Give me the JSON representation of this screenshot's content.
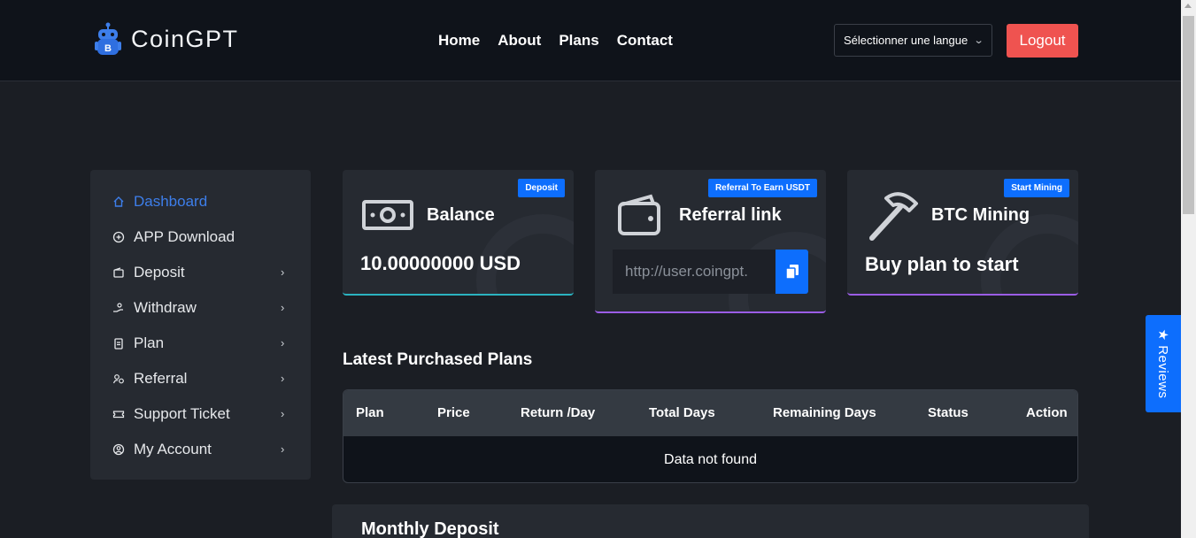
{
  "brand": {
    "name": "CoinGPT",
    "logo_icon": "robot-bitcoin-icon"
  },
  "nav": {
    "items": [
      "Home",
      "About",
      "Plans",
      "Contact"
    ]
  },
  "header": {
    "language_select": "Sélectionner une langue",
    "logout_label": "Logout"
  },
  "sidebar": {
    "items": [
      {
        "label": "Dashboard",
        "icon": "home-icon",
        "active": true,
        "has_submenu": false
      },
      {
        "label": "APP Download",
        "icon": "plus-circle-icon",
        "active": false,
        "has_submenu": false
      },
      {
        "label": "Deposit",
        "icon": "wallet-icon",
        "active": false,
        "has_submenu": true
      },
      {
        "label": "Withdraw",
        "icon": "hand-coin-icon",
        "active": false,
        "has_submenu": true
      },
      {
        "label": "Plan",
        "icon": "clipboard-icon",
        "active": false,
        "has_submenu": true
      },
      {
        "label": "Referral",
        "icon": "users-icon",
        "active": false,
        "has_submenu": true
      },
      {
        "label": "Support Ticket",
        "icon": "ticket-icon",
        "active": false,
        "has_submenu": true
      },
      {
        "label": "My Account",
        "icon": "user-circle-icon",
        "active": false,
        "has_submenu": true
      }
    ]
  },
  "cards": {
    "balance": {
      "title": "Balance",
      "value": "10.00000000 USD",
      "badge": "Deposit",
      "icon": "money-bill-icon",
      "accent": "#2bb3c0"
    },
    "referral": {
      "title": "Referral link",
      "link": "http://user.coingpt.",
      "badge": "Referral To Earn USDT",
      "icon": "wallet-icon",
      "accent": "#9b5de5"
    },
    "mining": {
      "title": "BTC Mining",
      "value": "Buy plan to start",
      "badge": "Start Mining",
      "icon": "hammer-icon",
      "accent": "#9b5de5"
    }
  },
  "plans_table": {
    "title": "Latest Purchased Plans",
    "columns": [
      "Plan",
      "Price",
      "Return /Day",
      "Total Days",
      "Remaining Days",
      "Status",
      "Action"
    ],
    "empty_message": "Data not found"
  },
  "monthly_deposit": {
    "title": "Monthly Deposit"
  },
  "reviews_tab": {
    "label": "★ Reviews"
  },
  "colors": {
    "primary": "#0d6efd",
    "logout": "#ef5350",
    "background": "#1b1e24",
    "panel": "#262a31",
    "active": "#3d7eea"
  }
}
